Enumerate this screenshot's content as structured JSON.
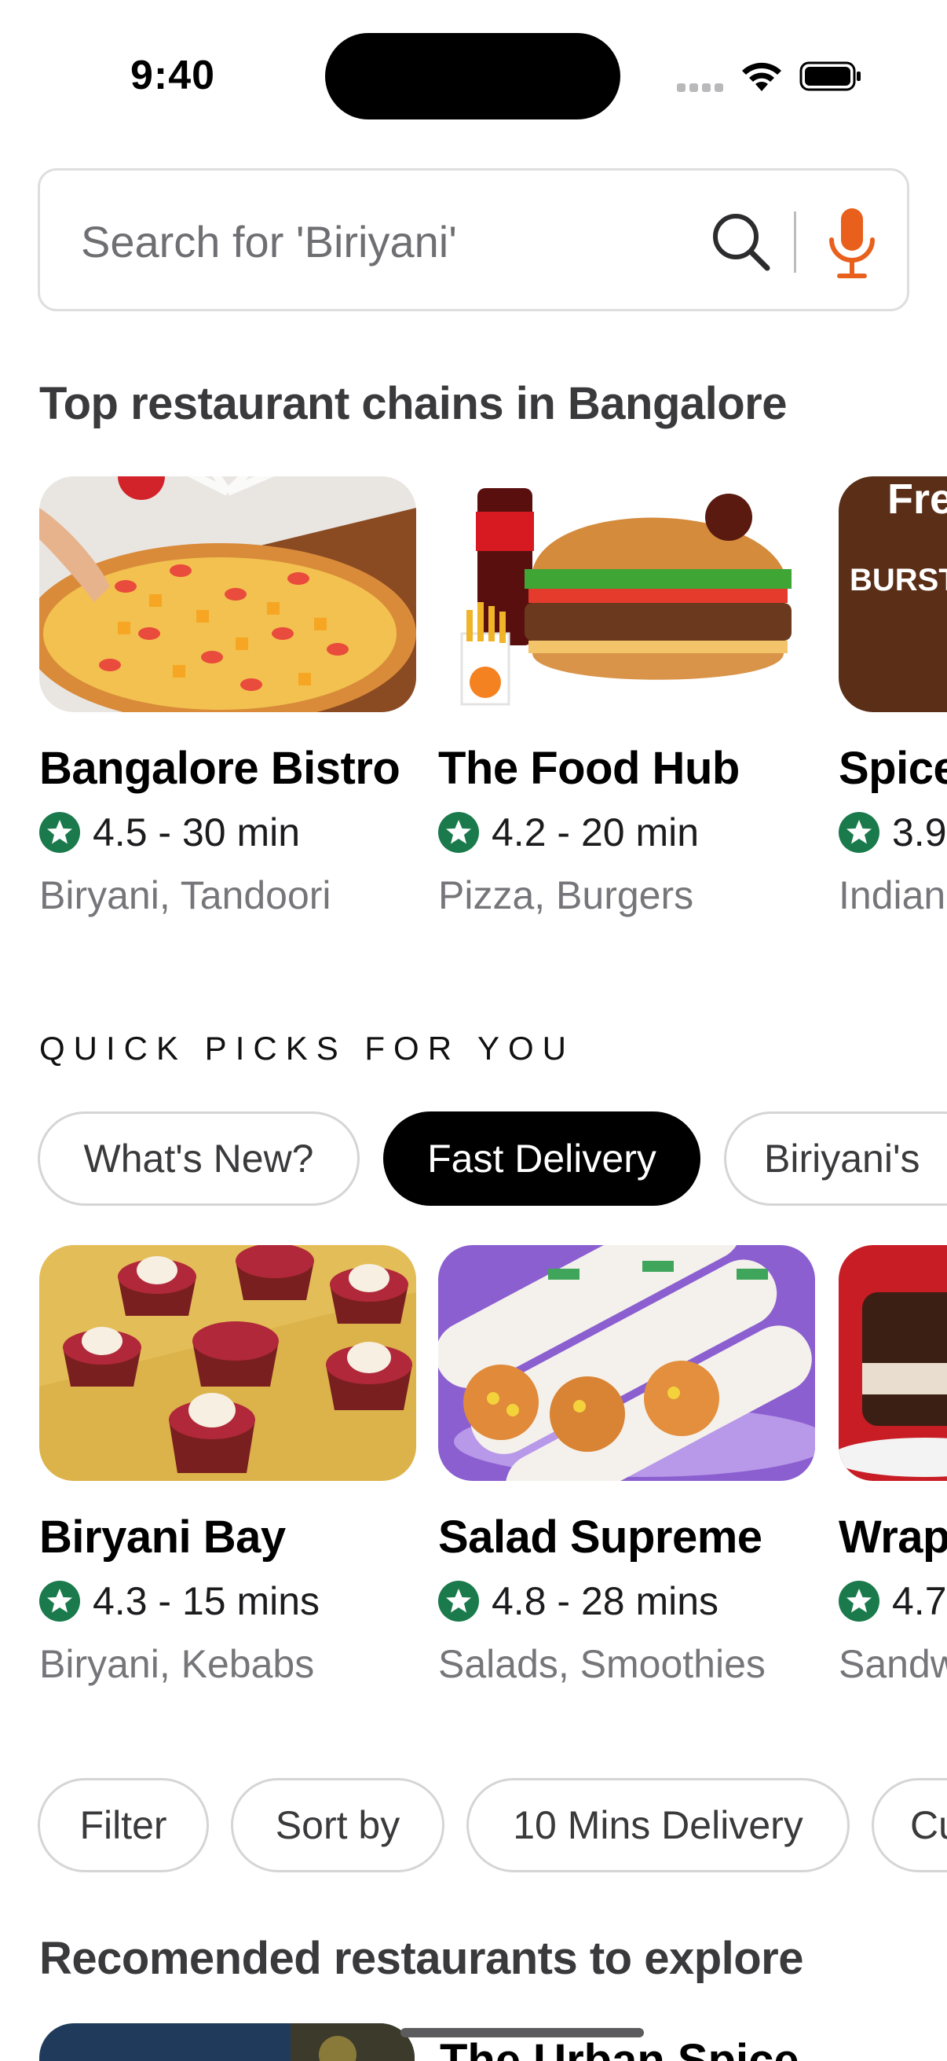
{
  "status_bar": {
    "time": "9:40"
  },
  "search": {
    "placeholder": "Search for 'Biriyani'"
  },
  "top_chains": {
    "title": "Top restaurant chains in Bangalore",
    "cards": [
      {
        "name": "Bangalore Bistro",
        "rating": "4.5 - 30 min",
        "cuisine": "Biryani, Tandoori",
        "image": "pizza-photo"
      },
      {
        "name": "The Food Hub",
        "rating": "4.2 - 20 min",
        "cuisine": "Pizza, Burgers",
        "image": "burger-photo"
      },
      {
        "name": "Spice",
        "rating": "3.9",
        "cuisine": "Indian",
        "image": "cheese-burst-photo",
        "image_text": "Fre",
        "image_subtext": "BURST"
      }
    ]
  },
  "quick_picks": {
    "title": "QUICK PICKS FOR YOU",
    "chips": [
      {
        "label": "What's New?",
        "active": false
      },
      {
        "label": "Fast Delivery",
        "active": true
      },
      {
        "label": "Biriyani's",
        "active": false
      }
    ],
    "cards": [
      {
        "name": "Biryani Bay",
        "rating": "4.3 - 15 mins",
        "cuisine": "Biryani, Kebabs",
        "image": "cupcakes-photo"
      },
      {
        "name": "Salad Supreme",
        "rating": "4.8 - 28 mins",
        "cuisine": "Salads, Smoothies",
        "image": "wraps-photo"
      },
      {
        "name": "Wrap",
        "rating": "4.7",
        "cuisine": "Sandw",
        "image": "chocolate-cake-photo"
      }
    ]
  },
  "filters": {
    "chips": [
      {
        "label": "Filter"
      },
      {
        "label": "Sort by"
      },
      {
        "label": "10 Mins Delivery"
      },
      {
        "label": "Cu"
      }
    ]
  },
  "recommended": {
    "title": "Recomended restaurants to explore",
    "first_card_name": "The Urban Spice"
  },
  "colors": {
    "accent_orange": "#e8601c",
    "rating_green": "#1a7a4c",
    "active_chip": "#000000",
    "muted_text": "#76767a"
  }
}
